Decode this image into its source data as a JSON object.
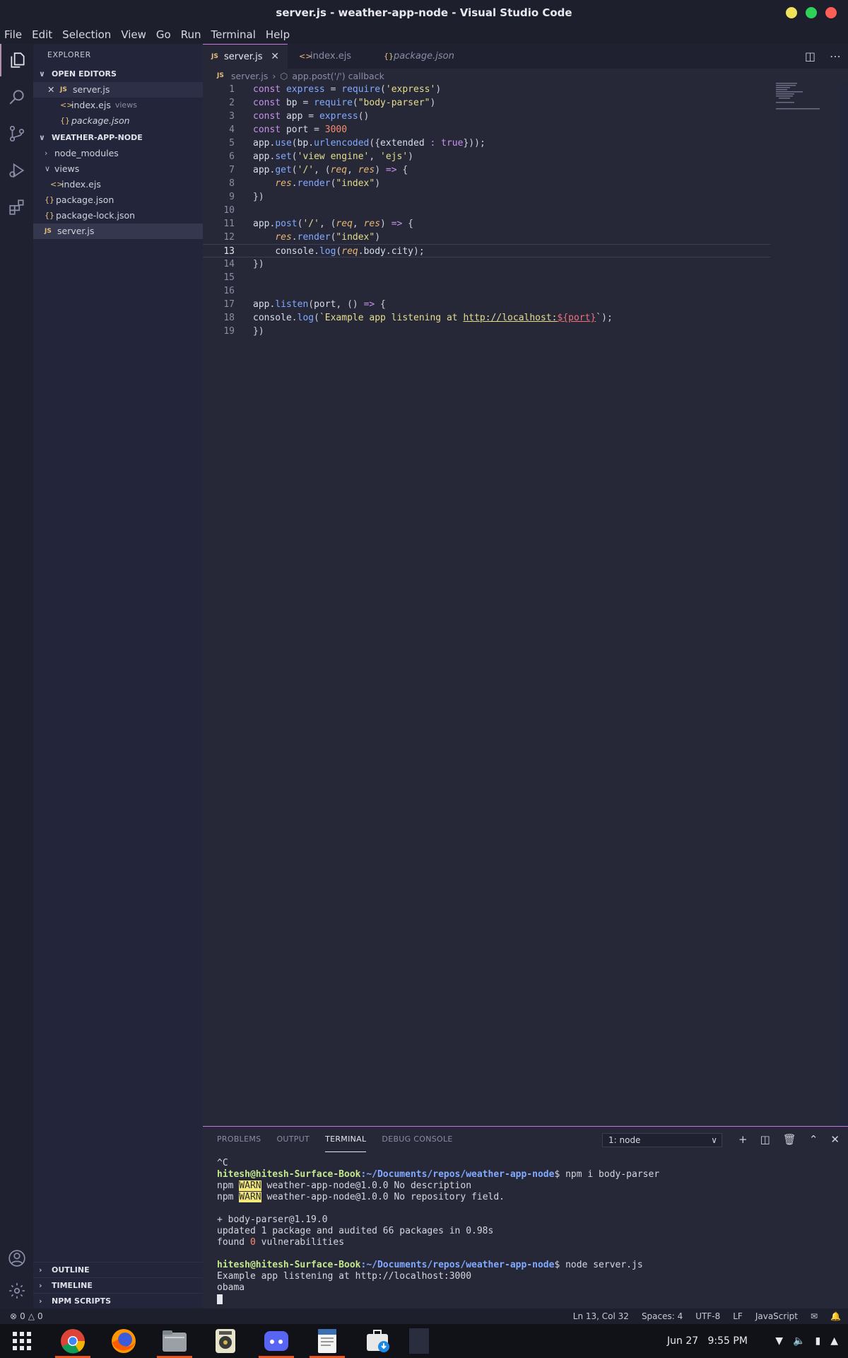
{
  "window": {
    "title": "server.js - weather-app-node - Visual Studio Code",
    "controls": [
      "#f0e25a",
      "#30d158",
      "#ff5f57"
    ]
  },
  "menu": [
    "File",
    "Edit",
    "Selection",
    "View",
    "Go",
    "Run",
    "Terminal",
    "Help"
  ],
  "sidebar": {
    "header": "EXPLORER",
    "open_editors_label": "OPEN EDITORS",
    "open_editors": [
      {
        "name": "server.js",
        "type": "js"
      },
      {
        "name": "index.ejs",
        "type": "ejs",
        "dir": "views"
      },
      {
        "name": "package.json",
        "type": "json"
      }
    ],
    "project_label": "WEATHER-APP-NODE",
    "tree": {
      "node_modules": "node_modules",
      "views": "views",
      "index_ejs": "index.ejs",
      "package_json": "package.json",
      "package_lock": "package-lock.json",
      "server_js": "server.js"
    },
    "outline": "OUTLINE",
    "timeline": "TIMELINE",
    "npm_scripts": "NPM SCRIPTS"
  },
  "tabs": [
    {
      "label": "server.js",
      "type": "js",
      "icon": "JS"
    },
    {
      "label": "index.ejs",
      "type": "ejs",
      "icon": "<>"
    },
    {
      "label": "package.json",
      "type": "json",
      "icon": "{}"
    }
  ],
  "breadcrumb": {
    "file": "server.js",
    "symbol": "app.post('/') callback"
  },
  "code": {
    "cursor_line": 13,
    "lines": [
      "const express = require('express')",
      "const bp = require(\"body-parser\")",
      "const app = express()",
      "const port = 3000",
      "app.use(bp.urlencoded({extended : true}));",
      "app.set('view engine', 'ejs')",
      "app.get('/', (req, res) => {",
      "    res.render(\"index\")",
      "})",
      "",
      "app.post('/', (req, res) => {",
      "    res.render(\"index\")",
      "    console.log(req.body.city);",
      "})",
      "",
      "",
      "app.listen(port, () => {",
      "console.log(`Example app listening at http://localhost:${port}`);",
      "})"
    ]
  },
  "panel": {
    "tabs": [
      "PROBLEMS",
      "OUTPUT",
      "TERMINAL",
      "DEBUG CONSOLE"
    ],
    "active_tab": "TERMINAL",
    "terminal_select": "1: node",
    "terminal": {
      "ctrl_c": "^C",
      "prompt_user": "hitesh@hitesh-Surface-Book",
      "prompt_path": ":~/Documents/repos/weather-app-node",
      "cmd1": "$ npm i body-parser",
      "warn_word": "WARN",
      "warn1_rest": " weather-app-node@1.0.0 No description",
      "warn2_rest": " weather-app-node@1.0.0 No repository field.",
      "npm": "npm ",
      "added": "+ body-parser@1.19.0",
      "updated": "updated 1 package and audited 66 packages in 0.98s",
      "found_a": "found ",
      "found_n": "0",
      "found_b": " vulnerabilities",
      "cmd2": "$ node server.js",
      "listen": "Example app listening at http://localhost:3000",
      "obama": "obama"
    }
  },
  "status": {
    "errors": "0",
    "warnings": "0",
    "position": "Ln 13, Col 32",
    "spaces": "Spaces: 4",
    "encoding": "UTF-8",
    "eol": "LF",
    "language": "JavaScript"
  },
  "taskbar": {
    "apps": [
      "app-grid",
      "chrome",
      "firefox",
      "files",
      "rhythmbox",
      "discord",
      "text-editor",
      "software-updater",
      "vscode"
    ],
    "date": "Jun 27",
    "time": "9:55 PM"
  }
}
